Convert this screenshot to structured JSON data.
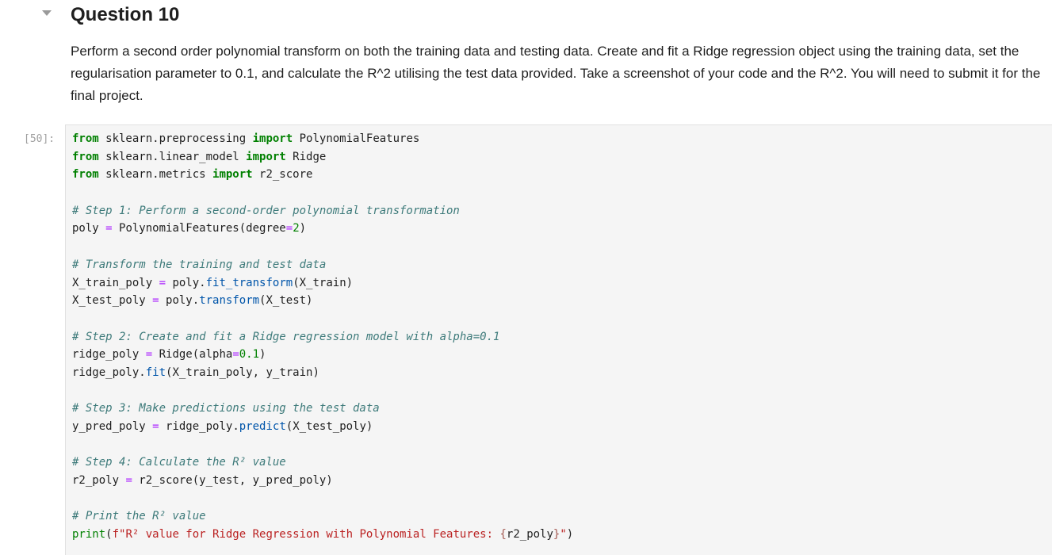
{
  "markdown_cell": {
    "heading": "Question 10",
    "paragraph": "Perform a second order polynomial transform on both the training data and testing data. Create and fit a Ridge regression object using the training data, set the regularisation parameter to 0.1, and calculate the R^2 utilising the test data provided. Take a screenshot of your code and the R^2. You will need to submit it for the final project."
  },
  "code_cell": {
    "prompt": "[50]:",
    "lines": [
      [
        {
          "t": "from",
          "c": "kw"
        },
        {
          "t": " sklearn.preprocessing "
        },
        {
          "t": "import",
          "c": "kw"
        },
        {
          "t": " PolynomialFeatures"
        }
      ],
      [
        {
          "t": "from",
          "c": "kw"
        },
        {
          "t": " sklearn.linear_model "
        },
        {
          "t": "import",
          "c": "kw"
        },
        {
          "t": " Ridge"
        }
      ],
      [
        {
          "t": "from",
          "c": "kw"
        },
        {
          "t": " sklearn.metrics "
        },
        {
          "t": "import",
          "c": "kw"
        },
        {
          "t": " r2_score"
        }
      ],
      [],
      [
        {
          "t": "# Step 1: Perform a second-order polynomial transformation",
          "c": "cm"
        }
      ],
      [
        {
          "t": "poly "
        },
        {
          "t": "=",
          "c": "op"
        },
        {
          "t": " PolynomialFeatures(degree"
        },
        {
          "t": "=",
          "c": "op"
        },
        {
          "t": "2",
          "c": "num"
        },
        {
          "t": ")"
        }
      ],
      [],
      [
        {
          "t": "# Transform the training and test data",
          "c": "cm"
        }
      ],
      [
        {
          "t": "X_train_poly "
        },
        {
          "t": "=",
          "c": "op"
        },
        {
          "t": " poly"
        },
        {
          "t": "."
        },
        {
          "t": "fit_transform",
          "c": "fn"
        },
        {
          "t": "(X_train)"
        }
      ],
      [
        {
          "t": "X_test_poly "
        },
        {
          "t": "=",
          "c": "op"
        },
        {
          "t": " poly"
        },
        {
          "t": "."
        },
        {
          "t": "transform",
          "c": "fn"
        },
        {
          "t": "(X_test)"
        }
      ],
      [],
      [
        {
          "t": "# Step 2: Create and fit a Ridge regression model with alpha=0.1",
          "c": "cm"
        }
      ],
      [
        {
          "t": "ridge_poly "
        },
        {
          "t": "=",
          "c": "op"
        },
        {
          "t": " Ridge(alpha"
        },
        {
          "t": "=",
          "c": "op"
        },
        {
          "t": "0.1",
          "c": "num"
        },
        {
          "t": ")"
        }
      ],
      [
        {
          "t": "ridge_poly"
        },
        {
          "t": "."
        },
        {
          "t": "fit",
          "c": "fn"
        },
        {
          "t": "(X_train_poly, y_train)"
        }
      ],
      [],
      [
        {
          "t": "# Step 3: Make predictions using the test data",
          "c": "cm"
        }
      ],
      [
        {
          "t": "y_pred_poly "
        },
        {
          "t": "=",
          "c": "op"
        },
        {
          "t": " ridge_poly"
        },
        {
          "t": "."
        },
        {
          "t": "predict",
          "c": "fn"
        },
        {
          "t": "(X_test_poly)"
        }
      ],
      [],
      [
        {
          "t": "# Step 4: Calculate the R² value",
          "c": "cm"
        }
      ],
      [
        {
          "t": "r2_poly "
        },
        {
          "t": "=",
          "c": "op"
        },
        {
          "t": " r2_score(y_test, y_pred_poly)"
        }
      ],
      [],
      [
        {
          "t": "# Print the R² value",
          "c": "cm"
        }
      ],
      [
        {
          "t": "print",
          "c": "bi"
        },
        {
          "t": "("
        },
        {
          "t": "f\"R² value for Ridge Regression with Polynomial Features: ",
          "c": "str"
        },
        {
          "t": "{",
          "c": "interp"
        },
        {
          "t": "r2_poly"
        },
        {
          "t": "}",
          "c": "interp"
        },
        {
          "t": "\"",
          "c": "str"
        },
        {
          "t": ")"
        }
      ]
    ]
  },
  "icons": {
    "collapser": "chevron-down-icon"
  },
  "colors": {
    "keyword": "#008000",
    "comment": "#3d7a7a",
    "operator": "#aa22ff",
    "number": "#008000",
    "method": "#0055aa",
    "string": "#ba2121",
    "prompt": "#a0a0a0",
    "editor_background": "#f5f5f5"
  }
}
